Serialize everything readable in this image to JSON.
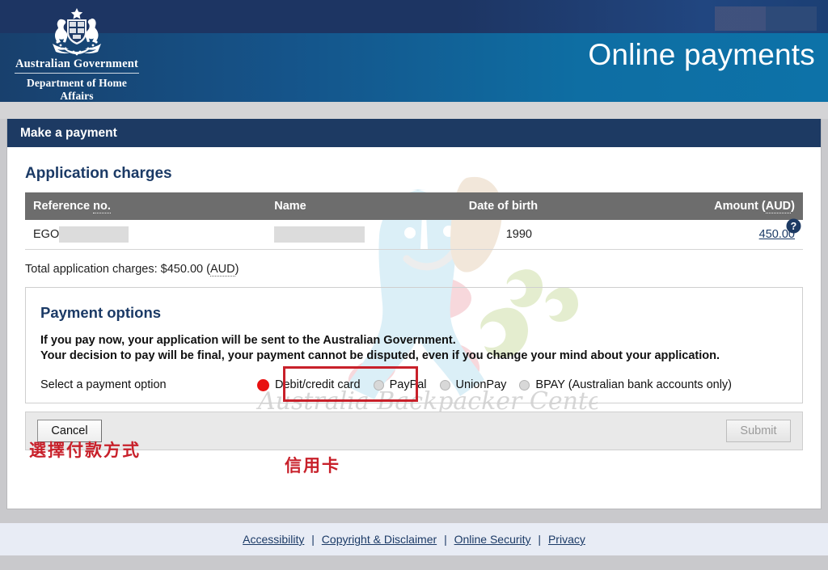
{
  "header": {
    "crest_alt": "australian-coat-of-arms",
    "gov_line1": "Australian Government",
    "gov_line2": "Department of Home Affairs",
    "site_title": "Online payments",
    "navy_color": "#1d3563",
    "teal_color": "#0e6ea3"
  },
  "card": {
    "title": "Make a payment",
    "section_title": "Application charges",
    "help_icon_label": "?"
  },
  "table": {
    "columns": [
      {
        "label": "Reference no.",
        "abbr": "no.",
        "align": "left"
      },
      {
        "label": "Name",
        "align": "left"
      },
      {
        "label": "Date of birth",
        "align": "left"
      },
      {
        "label": "Amount (AUD)",
        "abbr": "AUD",
        "align": "right"
      }
    ],
    "rows": [
      {
        "reference_prefix": "EGO",
        "reference_redacted": true,
        "name": "",
        "name_redacted": true,
        "date_of_birth": "1990",
        "amount": "450.00"
      }
    ]
  },
  "total": {
    "text": "Total application charges: $450.00 (AUD)",
    "label": "Total application charges:",
    "value": "$450.00",
    "currency": "AUD"
  },
  "payment_options": {
    "heading": "Payment options",
    "note_line1": "If you pay now, your application will be sent to the Australian Government.",
    "note_line2": "Your decision to pay will be final, your payment cannot be disputed, even if you change your mind about your application.",
    "select_label": "Select a payment option",
    "options": [
      {
        "label": "Debit/credit card",
        "selected": true
      },
      {
        "label": "PayPal",
        "selected": false
      },
      {
        "label": "UnionPay",
        "selected": false
      },
      {
        "label": "BPAY (Australian bank accounts only)",
        "selected": false
      }
    ],
    "highlight_color": "#c8202a",
    "selected_marker_color": "#e81010"
  },
  "actions": {
    "cancel_label": "Cancel",
    "submit_label": "Submit",
    "submit_disabled": true
  },
  "annotations": [
    {
      "text": "選擇付款方式",
      "color": "#c8202a"
    },
    {
      "text": "信用卡",
      "color": "#c8202a"
    }
  ],
  "watermark": {
    "text": "Australia Backpacker Center"
  },
  "footer": {
    "links": [
      {
        "label": "Accessibility"
      },
      {
        "label": "Copyright & Disclaimer"
      },
      {
        "label": "Online Security"
      },
      {
        "label": "Privacy"
      }
    ],
    "separator": "|"
  }
}
